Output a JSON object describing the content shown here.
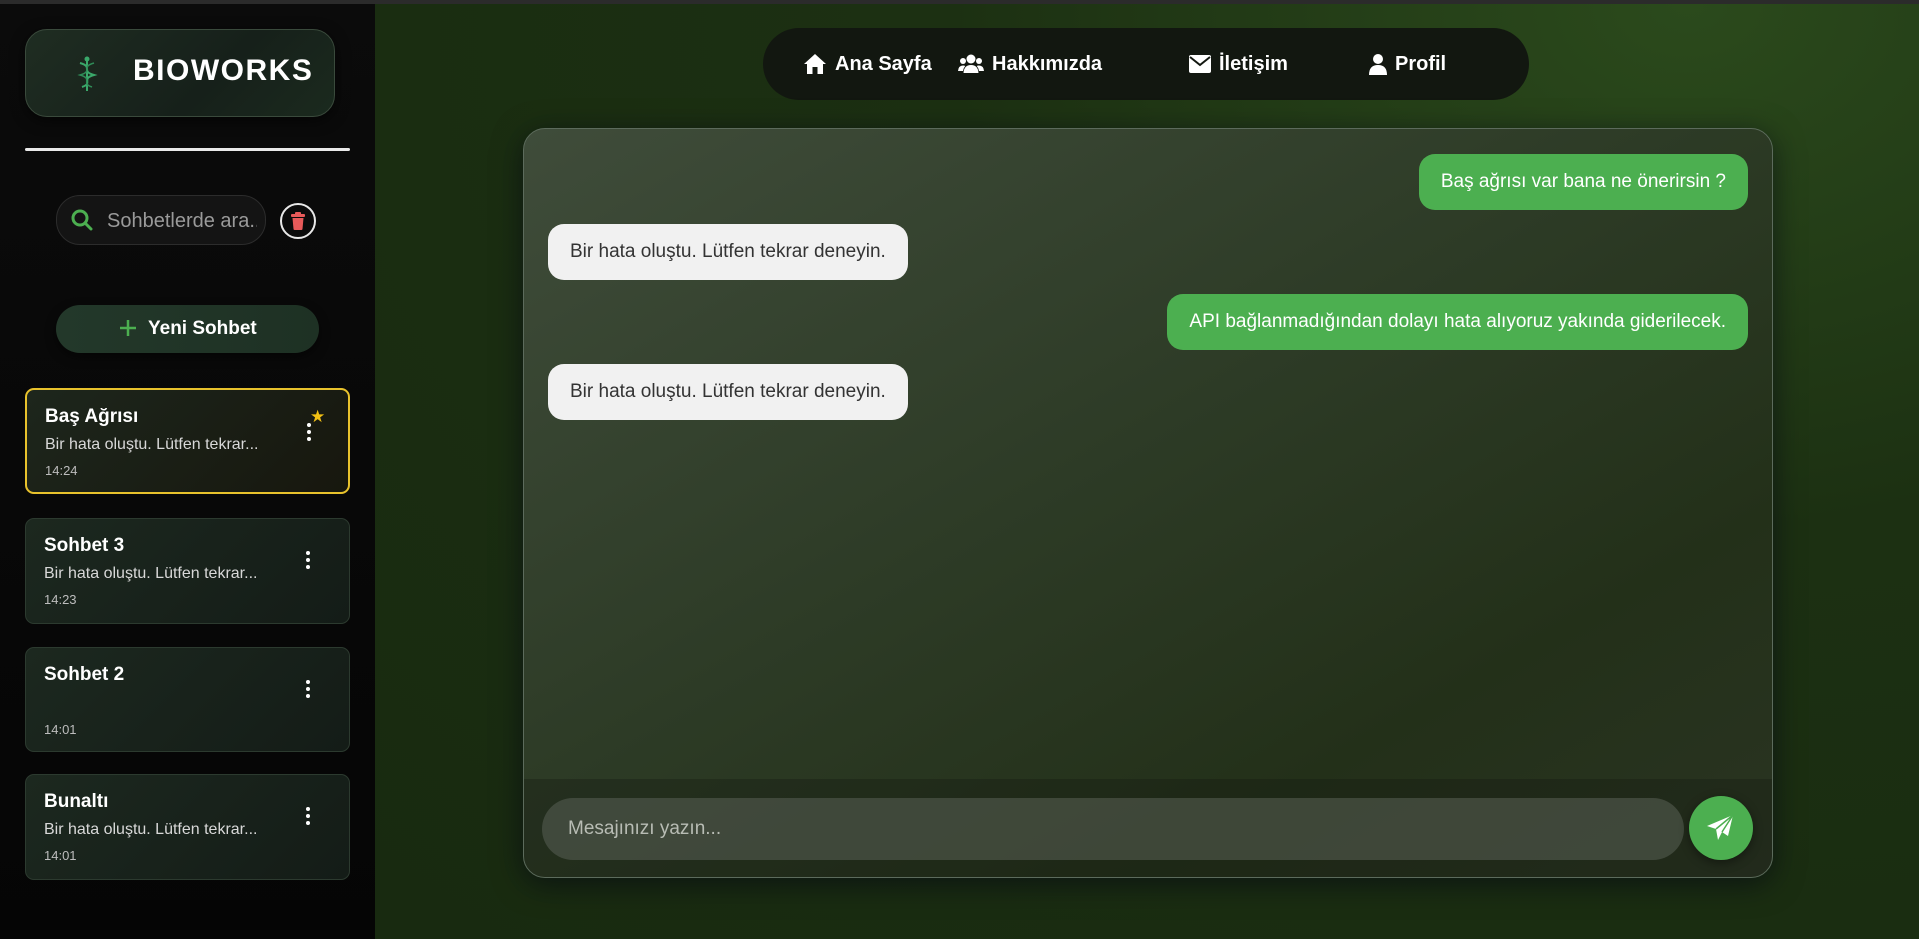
{
  "brand": {
    "name": "BIOWORKS",
    "icon": "dna-caduceus-icon"
  },
  "search": {
    "placeholder": "Sohbetlerde ara..",
    "icon": "search-icon"
  },
  "sidebar_actions": {
    "delete_icon": "trash-icon",
    "new_chat_label": "Yeni Sohbet"
  },
  "chats": [
    {
      "title": "Baş Ağrısı",
      "preview": "Bir hata oluştu. Lütfen tekrar...",
      "time": "14:24",
      "active": true,
      "starred": true
    },
    {
      "title": "Sohbet 3",
      "preview": "Bir hata oluştu. Lütfen tekrar...",
      "time": "14:23",
      "active": false,
      "starred": false
    },
    {
      "title": "Sohbet 2",
      "preview": "",
      "time": "14:01",
      "active": false,
      "starred": false
    },
    {
      "title": "Bunaltı",
      "preview": "Bir hata oluştu. Lütfen tekrar...",
      "time": "14:01",
      "active": false,
      "starred": false
    }
  ],
  "nav": [
    {
      "label": "Ana Sayfa",
      "icon": "home-icon"
    },
    {
      "label": "Hakkımızda",
      "icon": "users-icon"
    },
    {
      "label": "İletişim",
      "icon": "envelope-icon"
    },
    {
      "label": "Profil",
      "icon": "user-icon"
    }
  ],
  "messages": [
    {
      "role": "user",
      "text": "Baş ağrısı var bana ne önerirsin ?"
    },
    {
      "role": "bot",
      "text": "Bir hata oluştu. Lütfen tekrar deneyin."
    },
    {
      "role": "user",
      "text": "API bağlanmadığından dolayı hata alıyoruz yakında giderilecek."
    },
    {
      "role": "bot",
      "text": "Bir hata oluştu. Lütfen tekrar deneyin."
    }
  ],
  "composer": {
    "placeholder": "Mesajınızı yazın...",
    "send_icon": "paper-plane-icon"
  },
  "colors": {
    "accent": "#4caf50",
    "active_border": "#e8c22c",
    "star": "#f2c014",
    "danger": "#e85a5a"
  }
}
